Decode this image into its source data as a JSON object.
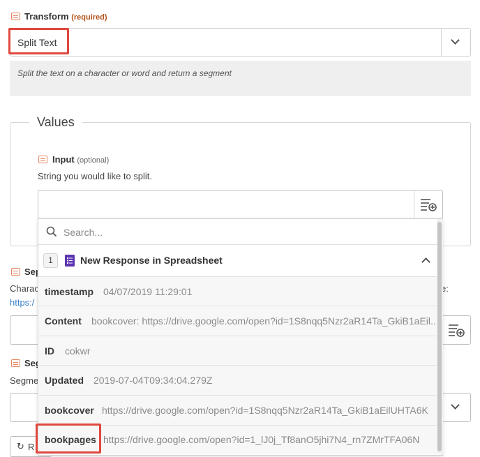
{
  "transform": {
    "label": "Transform",
    "required": "(required)",
    "selected": "Split Text",
    "help": "Split the text on a character or word and return a segment"
  },
  "values": {
    "legend": "Values",
    "input": {
      "label": "Input",
      "optional": "(optional)",
      "help": "String you would like to split.",
      "value": ""
    }
  },
  "dropdown": {
    "search_placeholder": "Search...",
    "step_number": "1",
    "step_title": "New Response in Spreadsheet",
    "rows": [
      {
        "key": "timestamp",
        "value": "04/07/2019 11:29:01"
      },
      {
        "key": "Content",
        "value": "bookcover: https://drive.google.com/open?id=1S8nqq5Nzr2aR14Ta_GkiB1aEil..."
      },
      {
        "key": "ID",
        "value": "cokwr"
      },
      {
        "key": "Updated",
        "value": "2019-07-04T09:34:04.279Z"
      },
      {
        "key": "bookcover",
        "value": "https://drive.google.com/open?id=1S8nqq5Nzr2aR14Ta_GkiB1aEilUHTA6K"
      },
      {
        "key": "bookpages",
        "value": "https://drive.google.com/open?id=1_lJ0j_Tf8anO5jhi7N4_rn7ZMrTFA06N"
      }
    ]
  },
  "behind": {
    "sep_label_partial": "Sep",
    "char_partial": "Charac",
    "link_partial": "https:/",
    "colon_partial": "e:",
    "seg_label_partial": "Seg",
    "segment_partial": "Segme",
    "button_partial": "R"
  },
  "colors": {
    "accent_red": "#e0483e",
    "field_icon": "#e8855f",
    "sheets_purple": "#5e35b1",
    "link_blue": "#3a7ec6"
  }
}
